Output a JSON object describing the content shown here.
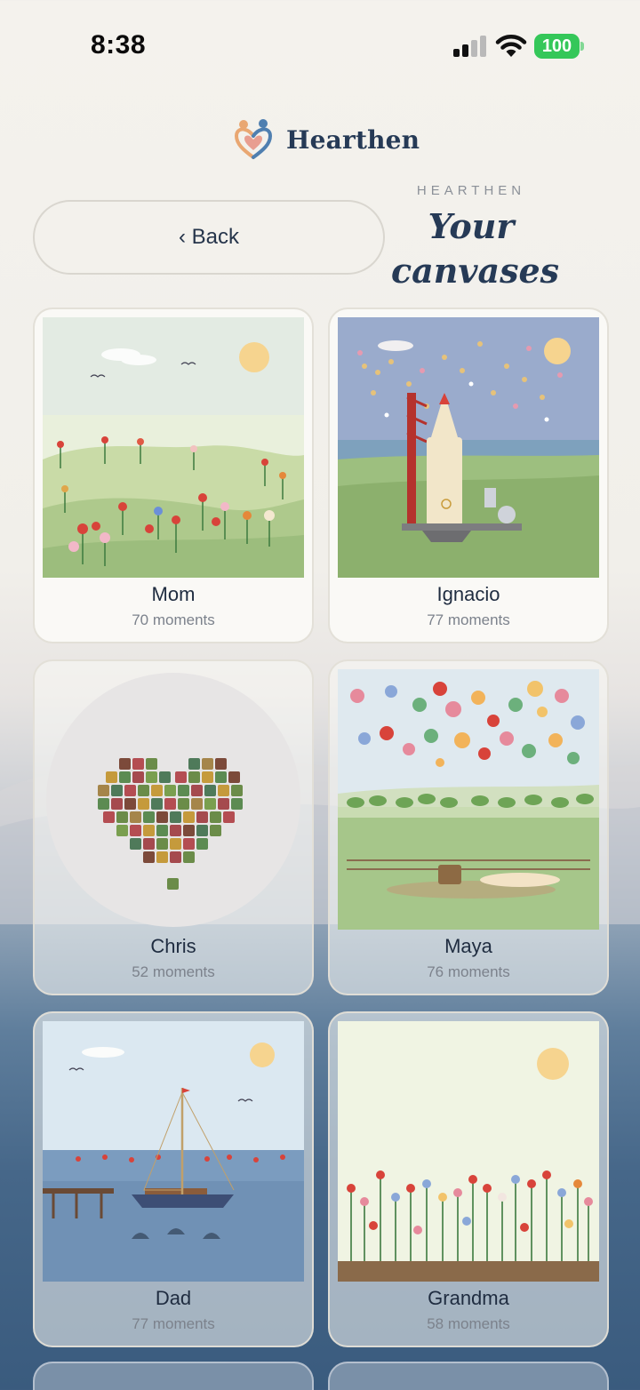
{
  "status_bar": {
    "time": "8:38",
    "battery": "100"
  },
  "brand": {
    "name": "Hearthen"
  },
  "header": {
    "back_label": "‹ Back",
    "eyebrow": "HEARTHEN",
    "title": "Your canvases"
  },
  "colors": {
    "brand_navy": "#263a56",
    "battery_green": "#34c759",
    "card_border": "#e1ded6"
  },
  "canvases": [
    {
      "name": "Mom",
      "moments": "70 moments",
      "scene": "flower-meadow"
    },
    {
      "name": "Ignacio",
      "moments": "77 moments",
      "scene": "rocket-launch"
    },
    {
      "name": "Chris",
      "moments": "52 moments",
      "scene": "heart-mosaic"
    },
    {
      "name": "Maya",
      "moments": "76 moments",
      "scene": "hot-air-balloons"
    },
    {
      "name": "Dad",
      "moments": "77 moments",
      "scene": "sailboat-harbor"
    },
    {
      "name": "Grandma",
      "moments": "58 moments",
      "scene": "flower-garden"
    }
  ]
}
